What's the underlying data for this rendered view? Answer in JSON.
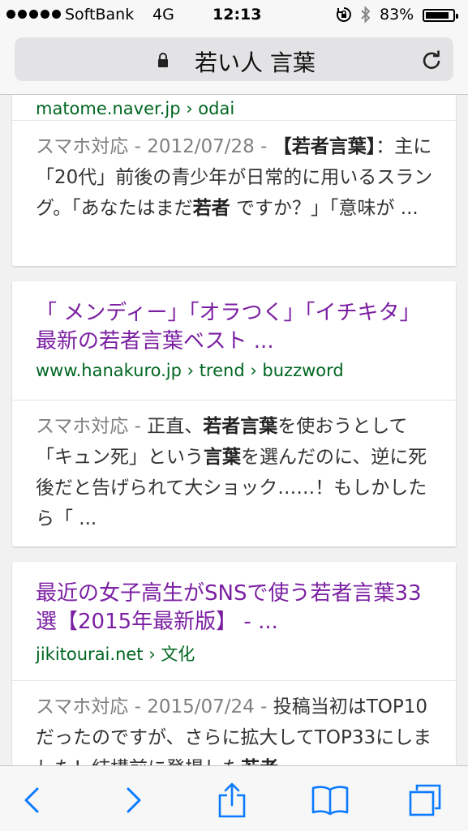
{
  "status": {
    "carrier": "SoftBank",
    "network": "4G",
    "time": "12:13",
    "battery_pct": "83%",
    "battery_level": 0.83,
    "icons": [
      "signal-dots-icon",
      "rotation-lock-icon",
      "bluetooth-icon",
      "battery-icon"
    ]
  },
  "address": {
    "query": "若い人 言葉",
    "icons": [
      "lock-icon",
      "reload-icon"
    ]
  },
  "results": {
    "r0": {
      "url_partial": "matome.naver.jp › odai",
      "meta": "スマホ対応 - 2012/07/28 - ",
      "s1": "【若者言葉】",
      "s2": "：主に「20代」前後の青少年が日常的に用いるスラング。「あなたはまだ",
      "s3": "若者",
      "s4": " ですか？」「意味が ..."
    },
    "r1": {
      "title": "「 メンディー」「オラつく」「イチキタ」最新の若者言葉ベスト ...",
      "url": "www.hanakuro.jp › trend › buzzword",
      "meta": "スマホ対応 - ",
      "s1": "正直、",
      "s2": "若者言葉",
      "s3": "を使おうとして「キュン死」という",
      "s4": "言葉",
      "s5": "を選んだのに、逆に死後だと告げられて大ショック……！もしかしたら「 ..."
    },
    "r2": {
      "title": "最近の女子高生がSNSで使う若者言葉33選【2015年最新版】 - ...",
      "url": "jikitourai.net › 文化",
      "meta": "スマホ対応 - 2015/07/24 - ",
      "s1": "投稿当初はTOP10だったのですが、さらに拡大してTOP33にしました！結構前に登場した",
      "s2": "若者"
    }
  },
  "toolbar": {
    "icons": [
      "back-icon",
      "forward-icon",
      "share-icon",
      "bookmarks-icon",
      "tabs-icon"
    ]
  }
}
